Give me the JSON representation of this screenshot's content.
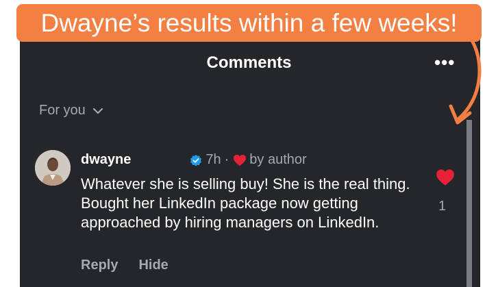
{
  "banner": {
    "text": "Dwayne’s results within a few weeks!"
  },
  "header": {
    "title": "Comments",
    "more_icon": "more-horizontal-icon"
  },
  "filter": {
    "label": "For you",
    "icon": "chevron-down-icon"
  },
  "comment": {
    "username": "dwayne",
    "verified_icon": "verified-badge-icon",
    "time": "7h",
    "separator": "·",
    "liked_by": "by author",
    "text": "Whatever she is selling buy! She is the real thing. Bought her LinkedIn package now getting approached by hiring managers on LinkedIn.",
    "like_count": "1",
    "reply_label": "Reply",
    "hide_label": "Hide"
  },
  "colors": {
    "banner": "#f47f43",
    "panel": "#25262a",
    "heart": "#e8213b",
    "verified": "#1d9bf0",
    "muted_text": "#a8a9ad"
  }
}
